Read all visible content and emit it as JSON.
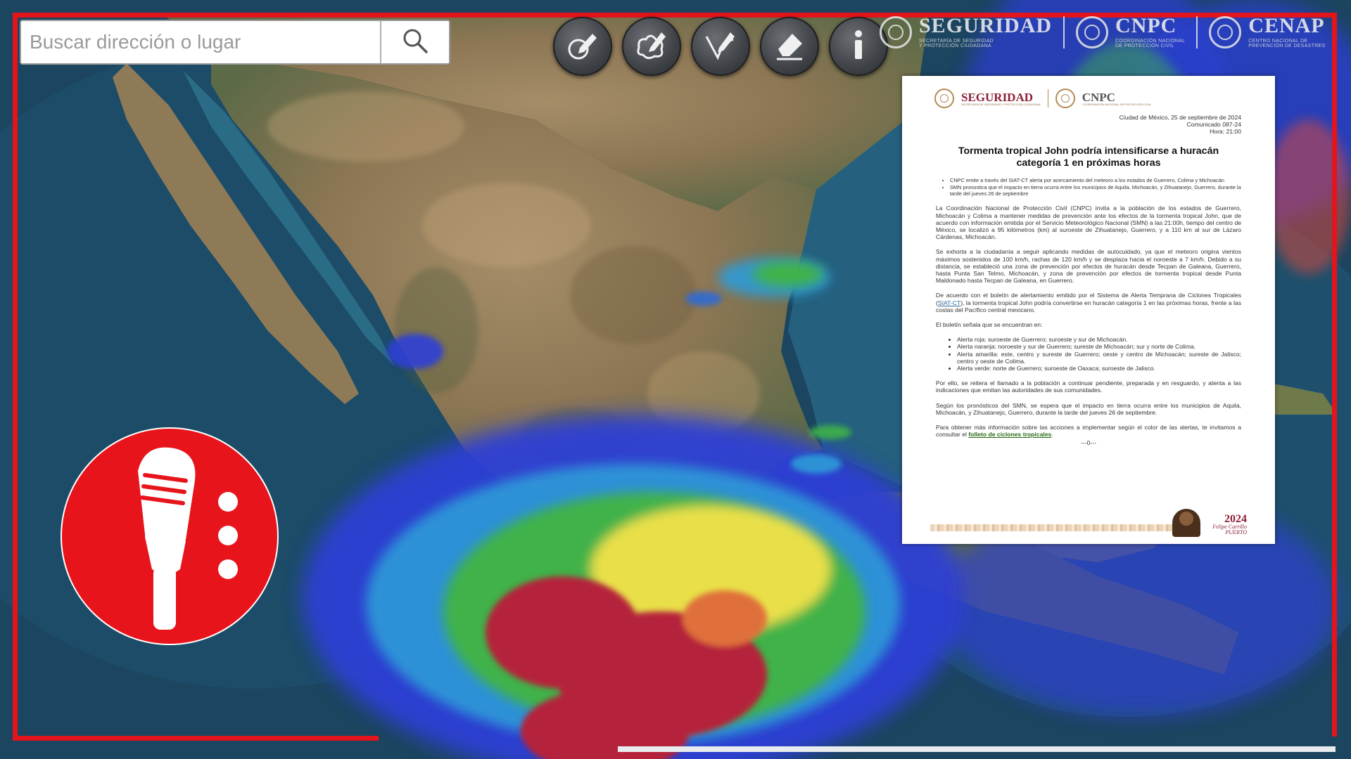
{
  "search": {
    "placeholder": "Buscar dirección o lugar",
    "button_icon": "search-icon"
  },
  "toolbar": {
    "tools": [
      {
        "icon": "draw-point-icon"
      },
      {
        "icon": "draw-polygon-icon"
      },
      {
        "icon": "draw-line-icon"
      },
      {
        "icon": "eraser-icon"
      },
      {
        "icon": "info-icon"
      }
    ]
  },
  "header_logos": [
    {
      "title": "SEGURIDAD",
      "subtitle": "SECRETARÍA DE SEGURIDAD\nY PROTECCIÓN CIUDADANA"
    },
    {
      "title": "CNPC",
      "subtitle": "COORDINACIÓN NACIONAL\nDE PROTECCIÓN CIVIL"
    },
    {
      "title": "CENAP",
      "subtitle": "CENTRO NACIONAL DE\nPREVENCIÓN DE DESASTRES"
    }
  ],
  "press_release": {
    "logo_left": {
      "title": "SEGURIDAD",
      "subtitle": "SECRETARÍA DE SEGURIDAD Y PROTECCIÓN CIUDADANA"
    },
    "logo_right": {
      "title": "CNPC",
      "subtitle": "COORDINACIÓN NACIONAL DE PROTECCIÓN CIVIL"
    },
    "place_date": "Ciudad de México, 25 de septiembre de 2024",
    "bulletin_number": "Comunicado 087-24",
    "time": "Hora: 21:00",
    "title": "Tormenta tropical John podría intensificarse a huracán categoría 1 en próximas horas",
    "bullets": [
      "CNPC emite a través del SIAT-CT alerta por acercamiento del meteoro a los estados de Guerrero, Colima y Michoacán",
      "SMN pronostica que el impacto en tierra ocurra entre los municipios de Aquila, Michoacán, y Zihuatanejo, Guerrero, durante la tarde del jueves 26 de septiembre"
    ],
    "p1": "La Coordinación Nacional de Protección Civil (CNPC) invita a la población de los estados de Guerrero, Michoacán y Colima a mantener medidas de prevención ante los efectos de la tormenta tropical John, que de acuerdo con información emitida por el Servicio Meteorológico Nacional (SMN) a las 21:00h, tiempo del centro de México, se localizó a 95 kilómetros (km) al suroeste de Zihuatanejo, Guerrero, y a 110 km al sur de Lázaro Cárdenas, Michoacán.",
    "p2": "Se exhorta a la ciudadanía a seguir aplicando medidas de autocuidado, ya que el meteoro origina vientos máximos sostenidos de 100 km/h, rachas de 120 km/h y se desplaza hacia el noroeste a 7 km/h. Debido a su distancia, se estableció una zona de prevención por efectos de huracán desde Tecpan de Galeana, Guerrero, hasta Punta San Telmo, Michoacán, y zona de prevención por efectos de tormenta tropical desde Punta Maldonado hasta Tecpan de Galeana, en Guerrero.",
    "p3_before": "De acuerdo con el boletín de alertamiento emitido por el Sistema de Alerta Temprana de Ciclones Tropicales (",
    "p3_link": "SIAT-CT",
    "p3_after": "), la tormenta tropical John podría convertirse en huracán categoría 1 en las próximas horas, frente a las costas del Pacífico central mexicano.",
    "p4": "El boletín señala que se encuentran en:",
    "alerts": [
      "Alerta roja: suroeste de Guerrero; suroeste y sur de Michoacán.",
      "Alerta naranja: noroeste y sur de Guerrero; sureste de Michoacán; sur y norte de Colima.",
      "Alerta amarilla: este, centro y sureste de Guerrero; oeste y centro de Michoacán; sureste de Jalisco; centro y oeste de Colima.",
      "Alerta verde: norte de Guerrero; suroeste de Oaxaca; suroeste de Jalisco."
    ],
    "p5": "Por ello, se reitera el llamado a la población a continuar pendiente, preparada y en resguardo, y atenta a las indicaciones que emitan las autoridades de sus comunidades.",
    "p6": "Según los pronósticos del SMN, se espera que el impacto en tierra ocurra entre los municipios de Aquila, Michoacán, y Zihuatanejo, Guerrero, durante la tarde del jueves 26 de septiembre.",
    "p7_before": "Para obtener más información sobre las acciones a implementar según el color de las alertas, te invitamos a consultar el ",
    "p7_link": "folleto de ciclones tropicales",
    "p7_after": ".",
    "separator": "---0---",
    "footer_year": "2024",
    "footer_name": "Felipe Carrillo\nPUERTO"
  },
  "podcast_badge": {
    "icon": "microphone-icon"
  },
  "colors": {
    "frame_red": "#e3141b",
    "badge_red": "#e8141b",
    "ocean": "#1f4864",
    "radar_red": "#b5233a",
    "radar_yellow": "#e9e04a",
    "radar_green": "#3fb24a",
    "radar_blue": "#2d3fd6"
  }
}
